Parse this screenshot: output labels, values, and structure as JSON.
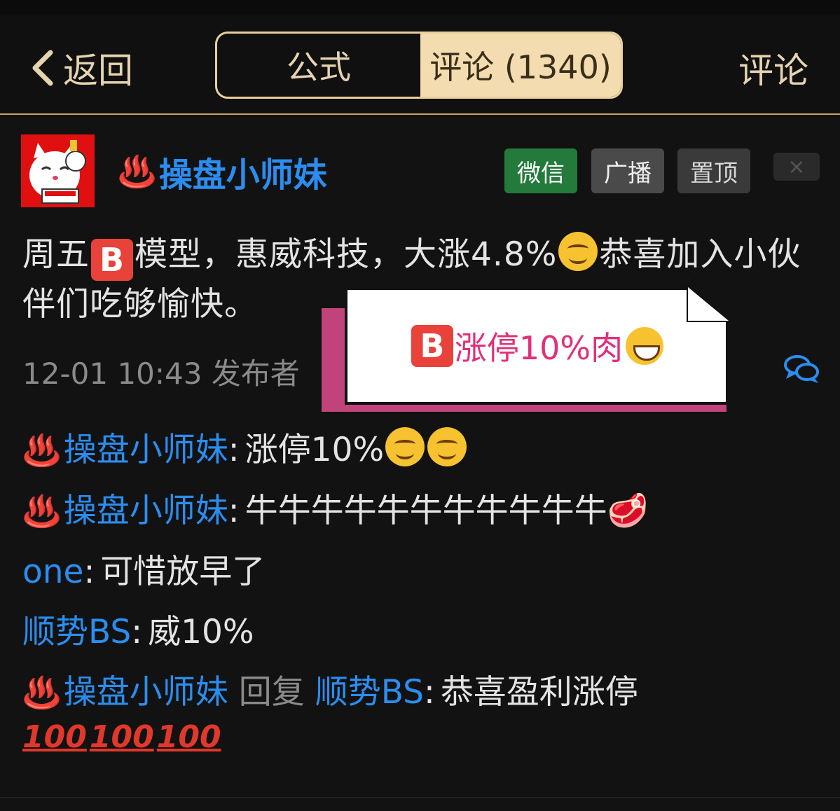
{
  "header": {
    "back_label": "返回",
    "tabs": [
      {
        "label": "公式"
      },
      {
        "label": "评论 (1340)"
      }
    ],
    "right_action": "评论"
  },
  "post": {
    "username": "操盘小师妹",
    "buttons": {
      "wechat": "微信",
      "broadcast": "广播",
      "pin": "置顶",
      "close": "×"
    },
    "text_part1": "周五",
    "text_part2": "模型，惠威科技，大涨4.8%",
    "text_part3": "恭喜加入小伙伴们吃够愉快。",
    "meta": "12-01 10:43 发布者"
  },
  "popup": {
    "text": "涨停10%肉"
  },
  "replies": [
    {
      "name": "操盘小师妹",
      "text": "涨停10%"
    },
    {
      "name": "操盘小师妹",
      "text": "牛牛牛牛牛牛牛牛牛牛牛"
    },
    {
      "name": "one",
      "text": "可惜放早了"
    },
    {
      "name": "顺势BS",
      "text": "威10%"
    },
    {
      "name": "操盘小师妹",
      "verb": "回复",
      "target": "顺势BS",
      "text": "恭喜盈利涨停"
    }
  ],
  "icons": {
    "hot_springs": "hot-springs-emoji",
    "b_button": "b-button-emoji",
    "smile": "smiling-face-emoji",
    "grin": "grinning-face-emoji",
    "meat": "meat-emoji",
    "hundred": "hundred-points-emoji"
  },
  "colors": {
    "accent": "#e8cf9c",
    "link": "#2b8df0",
    "wechat_green": "#237a3a",
    "popup_pink": "#e0307a"
  }
}
